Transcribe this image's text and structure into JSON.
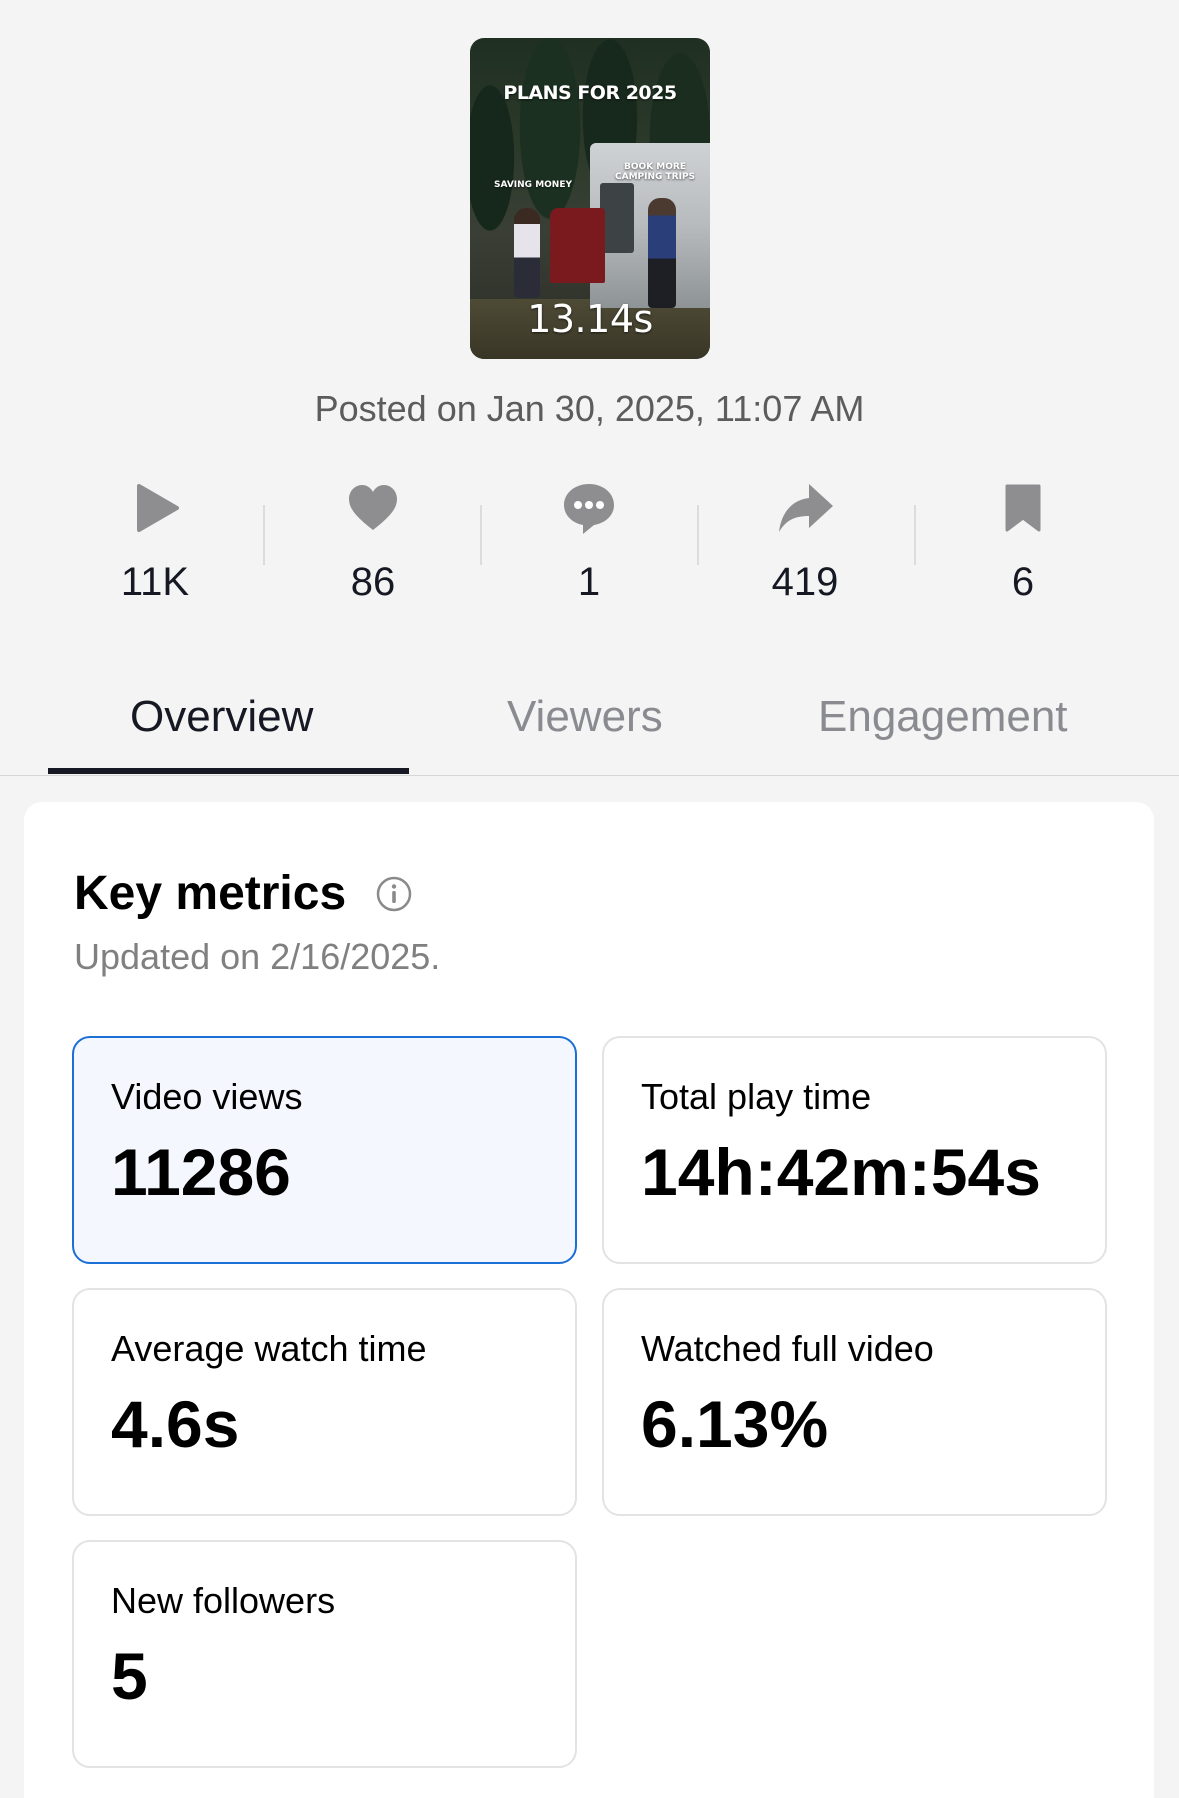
{
  "video": {
    "thumbnail_title": "PLANS FOR 2025",
    "thumbnail_label_left": "SAVING MONEY",
    "thumbnail_label_right_1": "BOOK MORE",
    "thumbnail_label_right_2": "CAMPING TRIPS",
    "duration": "13.14s",
    "posted": "Posted on Jan 30, 2025, 11:07 AM"
  },
  "stats": [
    {
      "icon": "play-icon",
      "value": "11K"
    },
    {
      "icon": "heart-icon",
      "value": "86"
    },
    {
      "icon": "comment-icon",
      "value": "1"
    },
    {
      "icon": "share-icon",
      "value": "419"
    },
    {
      "icon": "bookmark-icon",
      "value": "6"
    }
  ],
  "tabs": [
    {
      "label": "Overview",
      "active": true
    },
    {
      "label": "Viewers",
      "active": false
    },
    {
      "label": "Engagement",
      "active": false
    }
  ],
  "key_metrics": {
    "title": "Key metrics",
    "updated": "Updated on 2/16/2025.",
    "metrics": [
      {
        "label": "Video views",
        "value": "11286",
        "selected": true
      },
      {
        "label": "Total play time",
        "value": "14h:42m:54s",
        "selected": false
      },
      {
        "label": "Average watch time",
        "value": "4.6s",
        "selected": false
      },
      {
        "label": "Watched full video",
        "value": "6.13%",
        "selected": false
      },
      {
        "label": "New followers",
        "value": "5",
        "selected": false
      }
    ]
  },
  "colors": {
    "background": "#f4f4f4",
    "icon_gray": "#8e8e90",
    "selected_border": "#1b6fd6",
    "selected_fill": "#f4f7fd"
  }
}
